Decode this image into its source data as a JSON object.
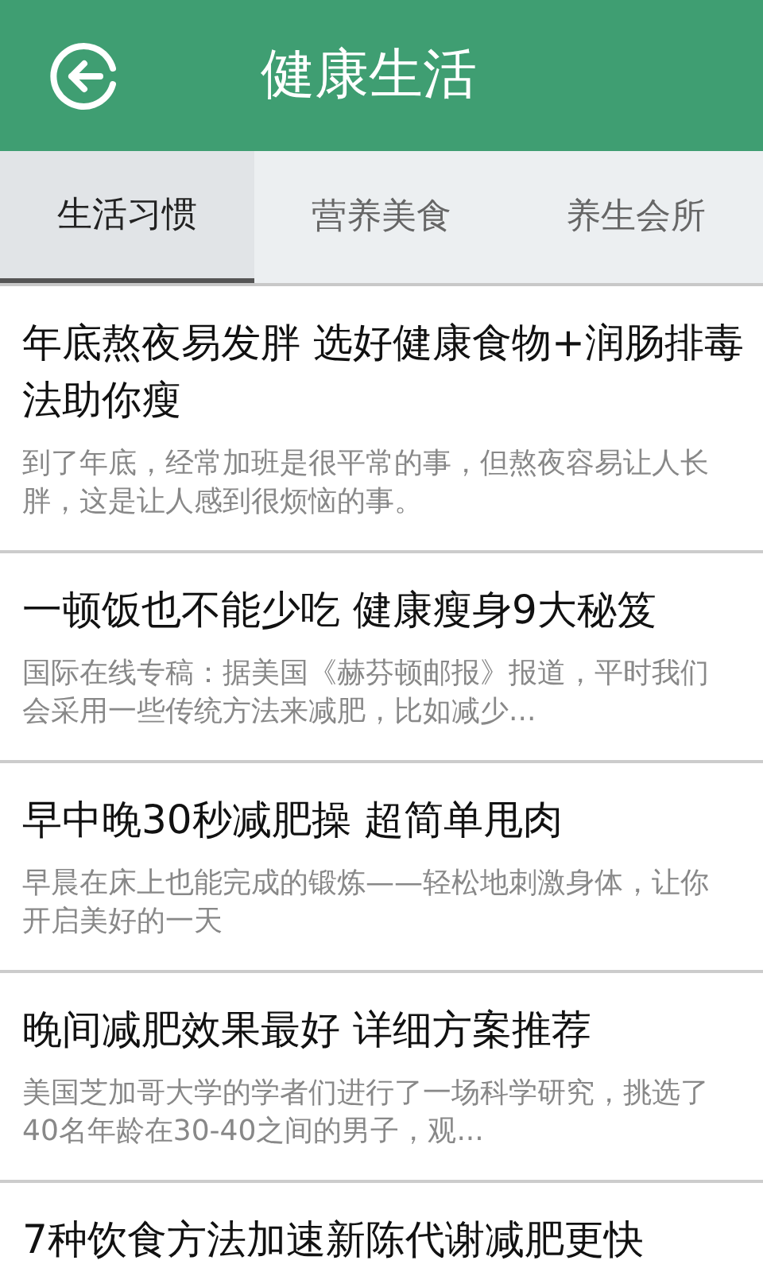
{
  "header": {
    "title": "健康生活"
  },
  "tabs": [
    {
      "label": "生活习惯",
      "selected": true
    },
    {
      "label": "营养美食",
      "selected": false
    },
    {
      "label": "养生会所",
      "selected": false
    }
  ],
  "articles": [
    {
      "title": "年底熬夜易发胖 选好健康食物+润肠排毒法助你瘦",
      "summary": "到了年底，经常加班是很平常的事，但熬夜容易让人长胖，这是让人感到很烦恼的事。"
    },
    {
      "title": "一顿饭也不能少吃 健康瘦身9大秘笈",
      "summary": "国际在线专稿：据美国《赫芬顿邮报》报道，平时我们会采用一些传统方法来减肥，比如减少..."
    },
    {
      "title": "早中晚30秒减肥操 超简单甩肉",
      "summary": "早晨在床上也能完成的锻炼——轻松地刺激身体，让你开启美好的一天"
    },
    {
      "title": "晚间减肥效果最好 详细方案推荐",
      "summary": "美国芝加哥大学的学者们进行了一场科学研究，挑选了40名年龄在30-40之间的男子，观..."
    },
    {
      "title": "7种饮食方法加速新陈代谢减肥更快"
    }
  ]
}
